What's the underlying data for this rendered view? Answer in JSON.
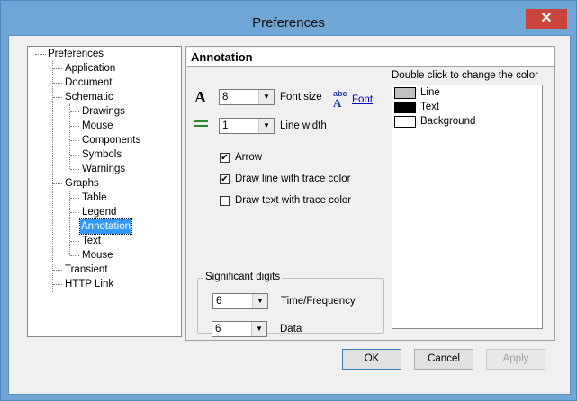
{
  "window": {
    "title": "Preferences",
    "close_glyph": "✕"
  },
  "tree": {
    "items": [
      {
        "label": "Preferences",
        "level": 0
      },
      {
        "label": "Application",
        "level": 1
      },
      {
        "label": "Document",
        "level": 1
      },
      {
        "label": "Schematic",
        "level": 1
      },
      {
        "label": "Drawings",
        "level": 2
      },
      {
        "label": "Mouse",
        "level": 2
      },
      {
        "label": "Components",
        "level": 2
      },
      {
        "label": "Symbols",
        "level": 2
      },
      {
        "label": "Warnings",
        "level": 2
      },
      {
        "label": "Graphs",
        "level": 1
      },
      {
        "label": "Table",
        "level": 2
      },
      {
        "label": "Legend",
        "level": 2
      },
      {
        "label": "Annotation",
        "level": 2,
        "selected": true
      },
      {
        "label": "Text",
        "level": 2
      },
      {
        "label": "Mouse",
        "level": 2
      },
      {
        "label": "Transient",
        "level": 1
      },
      {
        "label": "HTTP Link",
        "level": 1
      }
    ]
  },
  "panel": {
    "title": "Annotation",
    "font_size": {
      "value": "8",
      "label": "Font size"
    },
    "font_icon_text": "abc",
    "font_link": "Font",
    "line_width": {
      "value": "1",
      "label": "Line width"
    },
    "checkboxes": [
      {
        "label": "Arrow",
        "checked": true,
        "mark": "✔"
      },
      {
        "label": "Draw line with trace color",
        "checked": true,
        "mark": "✔"
      },
      {
        "label": "Draw text with trace color",
        "checked": false,
        "mark": ""
      }
    ],
    "significant_digits": {
      "title": "Significant digits",
      "time_frequency": {
        "value": "6",
        "label": "Time/Frequency"
      },
      "data": {
        "value": "6",
        "label": "Data"
      }
    },
    "colors": {
      "caption": "Double click to change the color",
      "items": [
        {
          "label": "Line",
          "color": "#c0c0c0"
        },
        {
          "label": "Text",
          "color": "#000000"
        },
        {
          "label": "Background",
          "color": "#ffffff"
        }
      ]
    }
  },
  "buttons": {
    "ok": "OK",
    "cancel": "Cancel",
    "apply": "Apply"
  },
  "icons": {
    "dropdown": "▼"
  },
  "colors": {
    "title_bar": "#6fa6d6",
    "close_button": "#c9443c",
    "selection": "#3399ff"
  }
}
